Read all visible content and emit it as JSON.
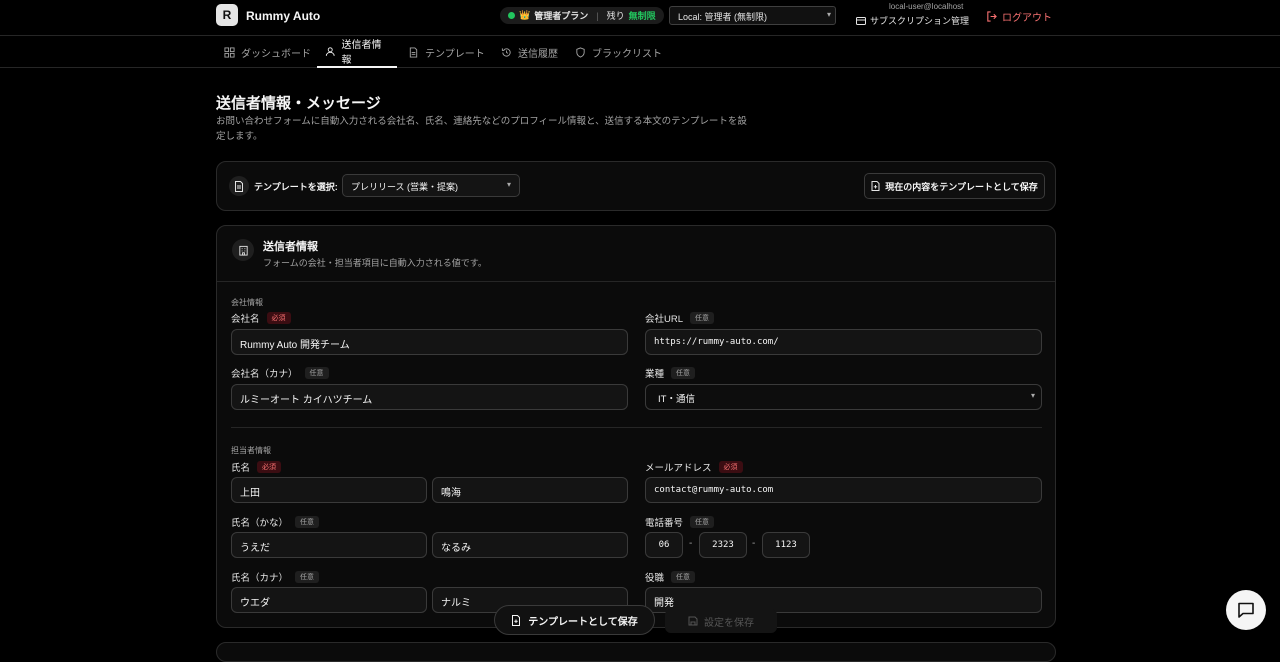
{
  "header": {
    "logo_letter": "R",
    "app_title": "Rummy Auto",
    "plan": {
      "emoji": "👑",
      "name": "管理者プラン",
      "remaining_label": "残り",
      "remaining_value": "無制限"
    },
    "user_select": "Local: 管理者 (無制限)",
    "user_email": "local-user@localhost",
    "subscription_label": "サブスクリプション管理",
    "logout_label": "ログアウト"
  },
  "tabs": [
    {
      "label": "ダッシュボード",
      "icon": "dashboard-icon"
    },
    {
      "label": "送信者情報",
      "icon": "user-icon",
      "active": true
    },
    {
      "label": "テンプレート",
      "icon": "file-icon"
    },
    {
      "label": "送信履歴",
      "icon": "history-icon"
    },
    {
      "label": "ブラックリスト",
      "icon": "shield-icon"
    }
  ],
  "page": {
    "title": "送信者情報・メッセージ",
    "description": "お問い合わせフォームに自動入力される会社名、氏名、連絡先などのプロフィール情報と、送信する本文のテンプレートを設定します。"
  },
  "template_bar": {
    "label": "テンプレートを選択:",
    "selected": "プレリリース (営業・提案)",
    "save_button": "現在の内容をテンプレートとして保存"
  },
  "sender": {
    "title": "送信者情報",
    "description": "フォームの会社・担当者項目に自動入力される値です。",
    "company_section": "会社情報",
    "contact_section": "担当者情報",
    "required": "必須",
    "optional": "任意",
    "fields": {
      "company_name": {
        "label": "会社名",
        "value": "Rummy Auto 開発チーム"
      },
      "company_url": {
        "label": "会社URL",
        "value": "https://rummy-auto.com/"
      },
      "company_kana": {
        "label": "会社名（カナ）",
        "value": "ルミーオート カイハツチーム"
      },
      "industry": {
        "label": "業種",
        "value": "IT・通信"
      },
      "name": {
        "label": "氏名",
        "last": "上田",
        "first": "鳴海"
      },
      "email": {
        "label": "メールアドレス",
        "value": "contact@rummy-auto.com"
      },
      "name_hira": {
        "label": "氏名（かな）",
        "last": "うえだ",
        "first": "なるみ"
      },
      "phone": {
        "label": "電話番号",
        "p1": "06",
        "p2": "2323",
        "p3": "1123",
        "sep": "-"
      },
      "name_kana": {
        "label": "氏名（カナ）",
        "last": "ウエダ",
        "first": "ナルミ"
      },
      "position": {
        "label": "役職",
        "value": "開発"
      }
    }
  },
  "footer": {
    "save_template_button": "テンプレートとして保存",
    "save_settings_button": "設定を保存"
  }
}
